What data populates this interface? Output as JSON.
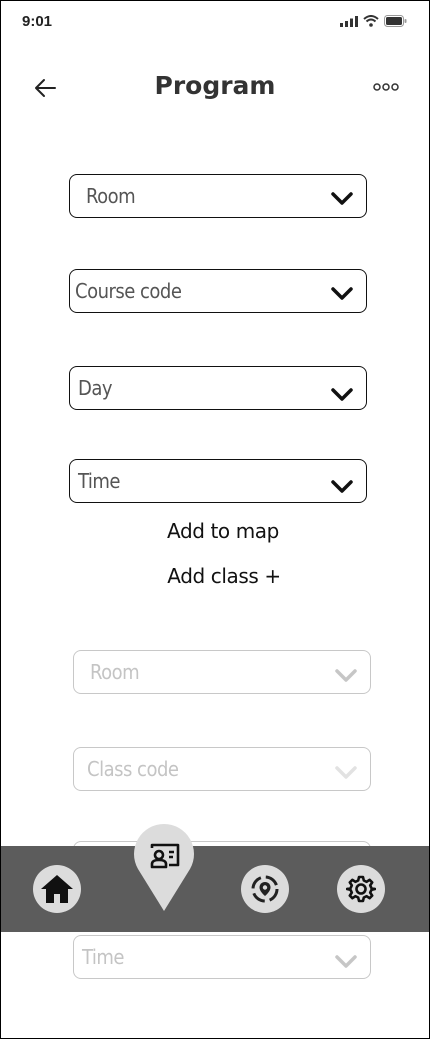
{
  "status_bar": {
    "time": "9:01"
  },
  "header": {
    "title": "Program"
  },
  "form": {
    "room": "Room",
    "course_code": "Course code",
    "day": "Day",
    "time": "Time"
  },
  "actions": {
    "add_to_map": "Add to map",
    "add_class": "Add class +"
  },
  "class_form": {
    "room": "Room",
    "class_code": "Class code",
    "time": "Time"
  },
  "icons": {
    "back": "arrow-left-icon",
    "more": "more-dots-icon",
    "home": "home-icon",
    "classroom": "classroom-icon",
    "location": "location-icon",
    "settings": "gear-icon"
  },
  "colors": {
    "nav_bar": "#5c5c5c",
    "nav_button": "#dcdcdc"
  }
}
